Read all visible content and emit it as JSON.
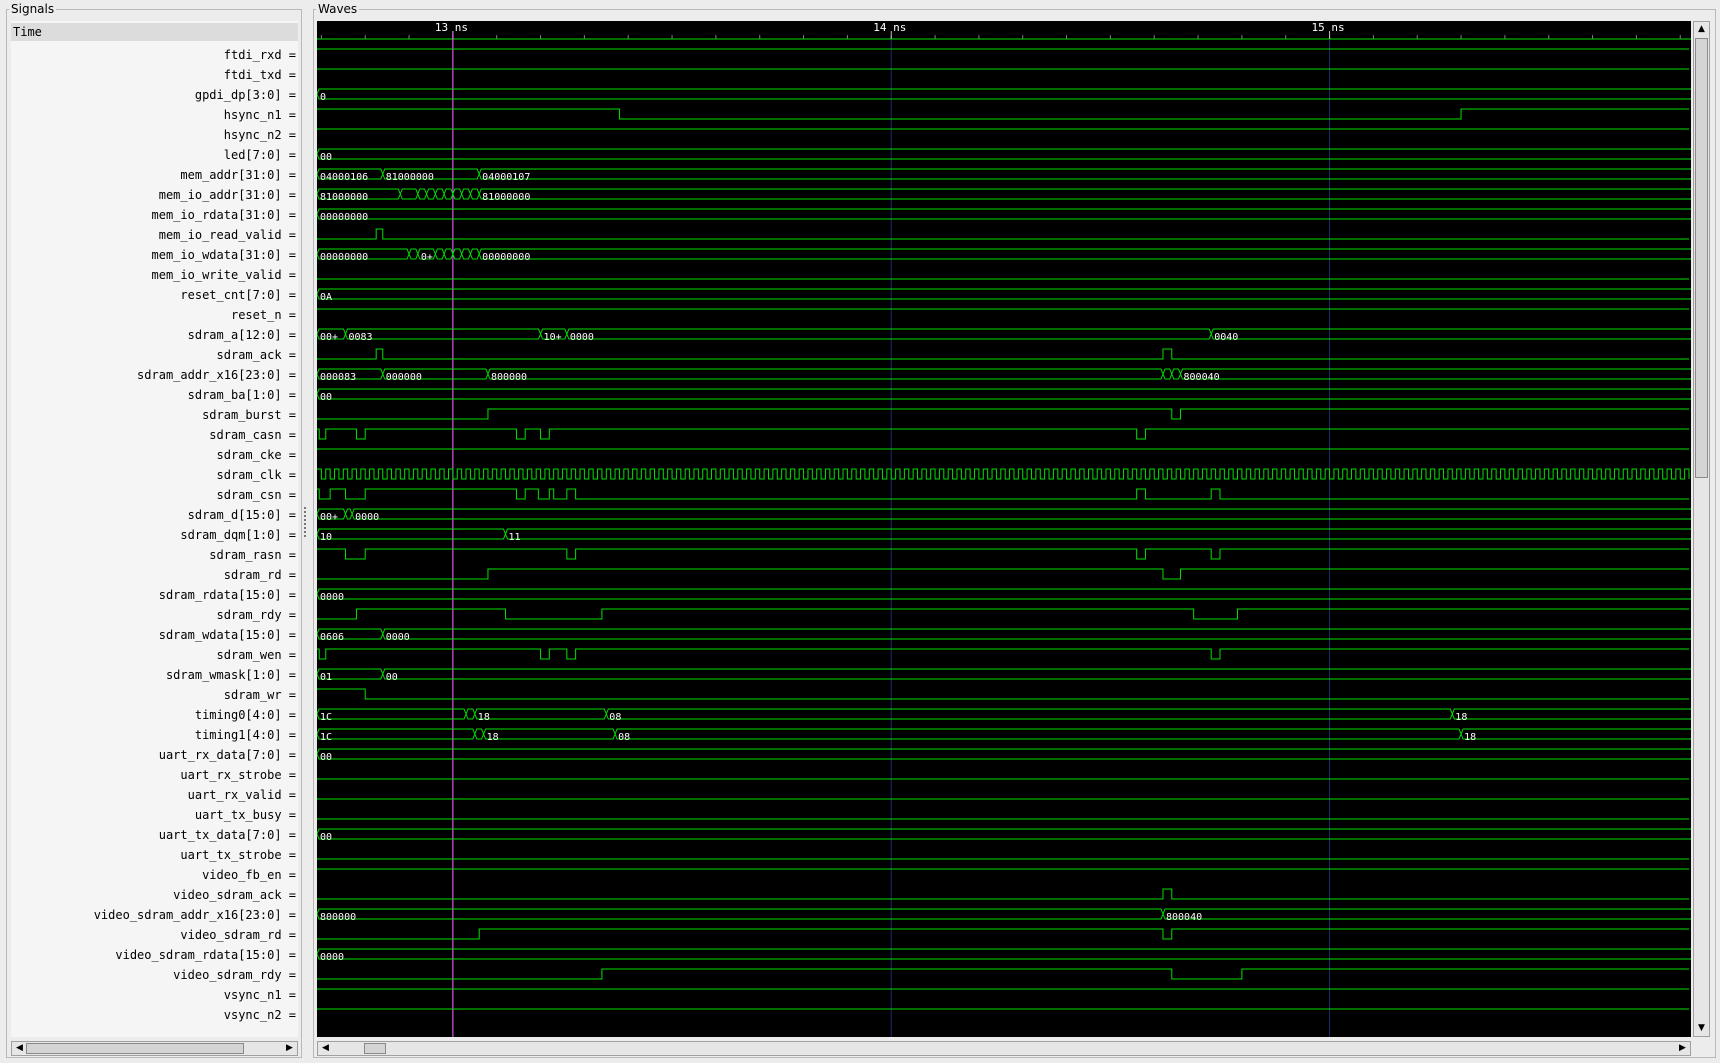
{
  "panes": {
    "signals_title": "Signals",
    "waves_title": "Waves"
  },
  "signals_header": "Time",
  "timeline": {
    "start_ns": 12.69,
    "end_ns": 15.82,
    "markers": [
      {
        "value": 13,
        "label": "13 ns"
      },
      {
        "value": 14,
        "label": "14 ns"
      },
      {
        "value": 15,
        "label": "15 ns"
      }
    ],
    "cursor_ns": 13.0,
    "colors": {
      "background": "#000000",
      "wave": "#00e000",
      "text": "#ffffff",
      "grid": "#1e2a6e",
      "cursor": "#ff60ff"
    }
  },
  "signals": [
    {
      "name": "ftdi_rxd =",
      "kind": "bit",
      "init": 1,
      "t": []
    },
    {
      "name": "ftdi_txd =",
      "kind": "bit",
      "init": 1,
      "t": []
    },
    {
      "name": "gpdi_dp[3:0] =",
      "kind": "bus",
      "t": [
        12.69
      ],
      "v": [
        "0"
      ]
    },
    {
      "name": "hsync_n1 =",
      "kind": "bit",
      "init": 1,
      "t": [
        13.38,
        15.3
      ],
      "s": [
        0,
        1
      ]
    },
    {
      "name": "hsync_n2 =",
      "kind": "bit",
      "init": 1,
      "t": []
    },
    {
      "name": "led[7:0] =",
      "kind": "bus",
      "t": [
        12.69
      ],
      "v": [
        "00"
      ]
    },
    {
      "name": "mem_addr[31:0] =",
      "kind": "bus",
      "t": [
        12.69,
        12.84,
        13.06
      ],
      "v": [
        "04000106",
        "81000000",
        "04000107"
      ]
    },
    {
      "name": "mem_io_addr[31:0] =",
      "kind": "bus",
      "t": [
        12.69,
        12.88,
        12.92,
        12.94,
        12.96,
        12.98,
        13.0,
        13.02,
        13.04,
        13.06
      ],
      "v": [
        "81000000",
        "",
        "",
        "",
        "",
        "",
        "",
        "",
        "",
        "81000000"
      ]
    },
    {
      "name": "mem_io_rdata[31:0] =",
      "kind": "bus",
      "t": [
        12.69
      ],
      "v": [
        "00000000"
      ]
    },
    {
      "name": "mem_io_read_valid =",
      "kind": "bit",
      "init": 0,
      "t": [
        12.825,
        12.84
      ],
      "s": [
        1,
        0
      ]
    },
    {
      "name": "mem_io_wdata[31:0] =",
      "kind": "bus",
      "t": [
        12.69,
        12.9,
        12.92,
        12.96,
        12.98,
        13.0,
        13.02,
        13.04,
        13.06
      ],
      "v": [
        "00000000",
        "",
        "0+",
        "",
        "",
        "",
        "",
        "",
        "00000000"
      ]
    },
    {
      "name": "mem_io_write_valid =",
      "kind": "bit",
      "init": 0,
      "t": []
    },
    {
      "name": "reset_cnt[7:0] =",
      "kind": "bus",
      "t": [
        12.69
      ],
      "v": [
        "0A"
      ]
    },
    {
      "name": "reset_n =",
      "kind": "bit",
      "init": 1,
      "t": []
    },
    {
      "name": "sdram_a[12:0] =",
      "kind": "bus",
      "t": [
        12.69,
        12.755,
        13.2,
        13.26,
        14.73
      ],
      "v": [
        "00+",
        "0083",
        "10+",
        "0000",
        "0040"
      ]
    },
    {
      "name": "sdram_ack =",
      "kind": "bit",
      "init": 0,
      "t": [
        12.825,
        12.84,
        14.62,
        14.64
      ],
      "s": [
        1,
        0,
        1,
        0
      ]
    },
    {
      "name": "sdram_addr_x16[23:0] =",
      "kind": "bus",
      "t": [
        12.69,
        12.84,
        13.08,
        14.62,
        14.64,
        14.66
      ],
      "v": [
        "000083",
        "000000",
        "800000",
        "",
        "",
        "800040"
      ]
    },
    {
      "name": "sdram_ba[1:0] =",
      "kind": "bus",
      "t": [
        12.69
      ],
      "v": [
        "00"
      ]
    },
    {
      "name": "sdram_burst =",
      "kind": "bit",
      "init": 0,
      "t": [
        13.08,
        14.64,
        14.66
      ],
      "s": [
        1,
        0,
        1
      ]
    },
    {
      "name": "sdram_casn =",
      "kind": "bit",
      "init": 1,
      "t": [
        12.695,
        12.71,
        12.78,
        12.8,
        13.145,
        13.165,
        13.2,
        13.22,
        14.56,
        14.58
      ],
      "s": [
        0,
        1,
        0,
        1,
        0,
        1,
        0,
        1,
        0,
        1
      ]
    },
    {
      "name": "sdram_cke =",
      "kind": "bit",
      "init": 1,
      "t": []
    },
    {
      "name": "sdram_clk =",
      "kind": "clock",
      "period": 0.02
    },
    {
      "name": "sdram_csn =",
      "kind": "bit",
      "init": 1,
      "t": [
        12.695,
        12.72,
        12.755,
        12.8,
        13.145,
        13.165,
        13.195,
        13.22,
        13.23,
        13.26,
        13.28,
        14.56,
        14.58,
        14.73,
        14.75
      ],
      "s": [
        0,
        1,
        0,
        1,
        0,
        1,
        0,
        1,
        0,
        1,
        0,
        1,
        0,
        1,
        0
      ]
    },
    {
      "name": "sdram_d[15:0] =",
      "kind": "bus",
      "t": [
        12.69,
        12.755,
        12.77
      ],
      "v": [
        "00+",
        "",
        "0000"
      ]
    },
    {
      "name": "sdram_dqm[1:0] =",
      "kind": "bus",
      "t": [
        12.69,
        13.12
      ],
      "v": [
        "10",
        "11"
      ]
    },
    {
      "name": "sdram_rasn =",
      "kind": "bit",
      "init": 1,
      "t": [
        12.755,
        12.8,
        13.26,
        13.28,
        14.56,
        14.58,
        14.73,
        14.75
      ],
      "s": [
        0,
        1,
        0,
        1,
        0,
        1,
        0,
        1
      ]
    },
    {
      "name": "sdram_rd =",
      "kind": "bit",
      "init": 0,
      "t": [
        13.08,
        14.62,
        14.66
      ],
      "s": [
        1,
        0,
        1
      ]
    },
    {
      "name": "sdram_rdata[15:0] =",
      "kind": "bus",
      "t": [
        12.69
      ],
      "v": [
        "0000"
      ]
    },
    {
      "name": "sdram_rdy =",
      "kind": "bit",
      "init": 0,
      "t": [
        12.78,
        13.12,
        13.34,
        14.69,
        14.79
      ],
      "s": [
        1,
        0,
        1,
        0,
        1
      ]
    },
    {
      "name": "sdram_wdata[15:0] =",
      "kind": "bus",
      "t": [
        12.69,
        12.84
      ],
      "v": [
        "0606",
        "0000"
      ]
    },
    {
      "name": "sdram_wen =",
      "kind": "bit",
      "init": 1,
      "t": [
        12.695,
        12.71,
        13.2,
        13.22,
        13.26,
        13.28,
        14.73,
        14.75
      ],
      "s": [
        0,
        1,
        0,
        1,
        0,
        1,
        0,
        1
      ]
    },
    {
      "name": "sdram_wmask[1:0] =",
      "kind": "bus",
      "t": [
        12.69,
        12.84
      ],
      "v": [
        "01",
        "00"
      ]
    },
    {
      "name": "sdram_wr =",
      "kind": "bit",
      "init": 1,
      "t": [
        12.8
      ],
      "s": [
        0
      ]
    },
    {
      "name": "timing0[4:0] =",
      "kind": "bus",
      "t": [
        12.69,
        13.03,
        13.05,
        13.35,
        15.28
      ],
      "v": [
        "1C",
        "",
        "18",
        "08",
        "18"
      ]
    },
    {
      "name": "timing1[4:0] =",
      "kind": "bus",
      "t": [
        12.69,
        13.05,
        13.07,
        13.37,
        15.3
      ],
      "v": [
        "1C",
        "",
        "18",
        "08",
        "18"
      ]
    },
    {
      "name": "uart_rx_data[7:0] =",
      "kind": "bus",
      "t": [
        12.69
      ],
      "v": [
        "00"
      ]
    },
    {
      "name": "uart_rx_strobe =",
      "kind": "bit",
      "init": 0,
      "t": []
    },
    {
      "name": "uart_rx_valid =",
      "kind": "bit",
      "init": 0,
      "t": []
    },
    {
      "name": "uart_tx_busy =",
      "kind": "bit",
      "init": 0,
      "t": []
    },
    {
      "name": "uart_tx_data[7:0] =",
      "kind": "bus",
      "t": [
        12.69
      ],
      "v": [
        "00"
      ]
    },
    {
      "name": "uart_tx_strobe =",
      "kind": "bit",
      "init": 0,
      "t": []
    },
    {
      "name": "video_fb_en =",
      "kind": "bit",
      "init": 1,
      "t": []
    },
    {
      "name": "video_sdram_ack =",
      "kind": "bit",
      "init": 0,
      "t": [
        14.62,
        14.64
      ],
      "s": [
        1,
        0
      ]
    },
    {
      "name": "video_sdram_addr_x16[23:0] =",
      "kind": "bus",
      "t": [
        12.69,
        14.62
      ],
      "v": [
        "800000",
        "800040"
      ]
    },
    {
      "name": "video_sdram_rd =",
      "kind": "bit",
      "init": 0,
      "t": [
        13.06,
        14.62,
        14.64
      ],
      "s": [
        1,
        0,
        1
      ]
    },
    {
      "name": "video_sdram_rdata[15:0] =",
      "kind": "bus",
      "t": [
        12.69
      ],
      "v": [
        "0000"
      ]
    },
    {
      "name": "video_sdram_rdy =",
      "kind": "bit",
      "init": 0,
      "t": [
        13.34,
        14.64,
        14.8
      ],
      "s": [
        1,
        0,
        1
      ]
    },
    {
      "name": "vsync_n1 =",
      "kind": "bit",
      "init": 1,
      "t": []
    },
    {
      "name": "vsync_n2 =",
      "kind": "bit",
      "init": 1,
      "t": []
    }
  ]
}
